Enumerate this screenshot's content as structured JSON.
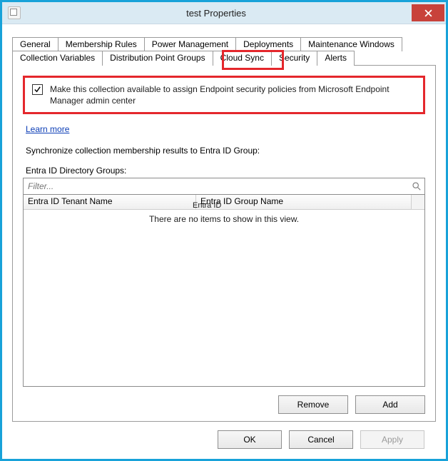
{
  "window": {
    "title": "test Properties",
    "close_glyph": "X"
  },
  "tabs": {
    "row1": [
      "General",
      "Membership Rules",
      "Power Management",
      "Deployments",
      "Maintenance Windows"
    ],
    "row2": [
      "Collection Variables",
      "Distribution Point Groups",
      "Cloud Sync",
      "Security",
      "Alerts"
    ],
    "selected": "Cloud Sync"
  },
  "cloudsync": {
    "checkbox_checked": true,
    "checkbox_label": "Make this collection available to assign Endpoint security policies from Microsoft Endpoint Manager admin center",
    "learn_more": "Learn more",
    "sync_label": "Synchronize collection membership results to  Entra ID Group:",
    "float_label": "Entra ID",
    "groups_label": "Entra ID Directory Groups:",
    "filter_placeholder": "Filter...",
    "columns": {
      "tenant": "Entra ID  Tenant  Name",
      "group": "Entra ID  Group  Name"
    },
    "empty_msg": "There are no items to show in this view.",
    "buttons": {
      "remove": "Remove",
      "add": "Add"
    }
  },
  "dialog_buttons": {
    "ok": "OK",
    "cancel": "Cancel",
    "apply": "Apply"
  }
}
